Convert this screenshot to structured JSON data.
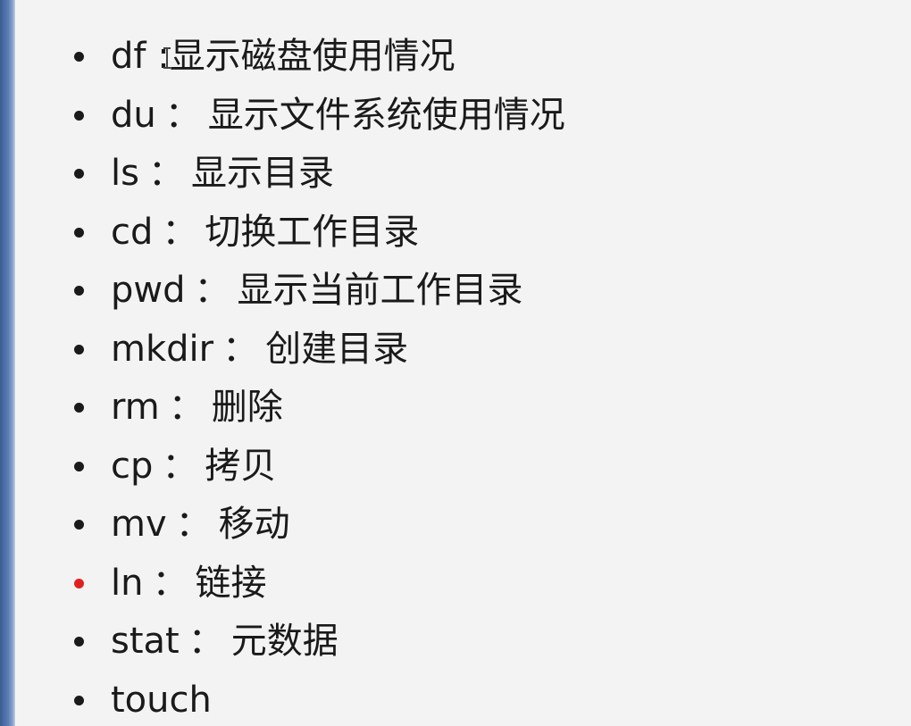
{
  "items": [
    {
      "cmd": "df",
      "sep": ":",
      "desc": "显示磁盘使用情况"
    },
    {
      "cmd": "du",
      "sep": "：",
      "desc": "显示文件系统使用情况"
    },
    {
      "cmd": "ls",
      "sep": "：",
      "desc": "显示目录"
    },
    {
      "cmd": "cd",
      "sep": "：",
      "desc": "切换工作目录"
    },
    {
      "cmd": "pwd",
      "sep": "：",
      "desc": "显示当前工作目录"
    },
    {
      "cmd": "mkdir",
      "sep": "：",
      "desc": "创建目录"
    },
    {
      "cmd": "rm",
      "sep": "：",
      "desc": "删除"
    },
    {
      "cmd": "cp",
      "sep": "：",
      "desc": "拷贝"
    },
    {
      "cmd": "mv",
      "sep": "：",
      "desc": "移动"
    },
    {
      "cmd": "ln",
      "sep": "：",
      "desc": "链接"
    },
    {
      "cmd": "stat",
      "sep": "：",
      "desc": "元数据"
    },
    {
      "cmd": "touch",
      "sep": "",
      "desc": ""
    }
  ],
  "highlight_color": "#e02020",
  "text_color": "#1a1a1a",
  "background_color": "#f3f3f3"
}
